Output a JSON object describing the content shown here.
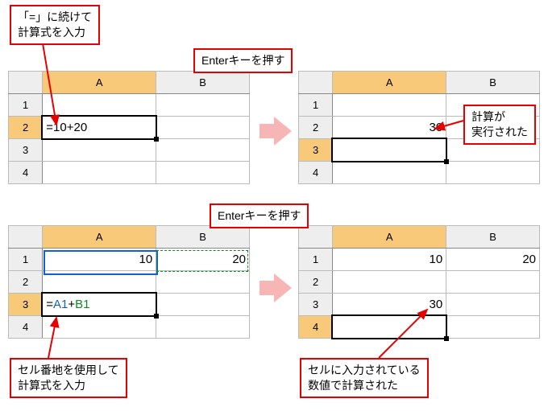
{
  "callouts": {
    "c1": "「=」に続けて\n計算式を入力",
    "c2": "Enterキーを押す",
    "c3": "計算が\n実行された",
    "c4": "Enterキーを押す",
    "c5": "セル番地を使用して\n計算式を入力",
    "c6": "セルに入力されている\n数値で計算された"
  },
  "headers": {
    "A": "A",
    "B": "B",
    "r1": "1",
    "r2": "2",
    "r3": "3",
    "r4": "4"
  },
  "grid1": {
    "a2": "=10+20"
  },
  "grid2": {
    "a2": "30"
  },
  "grid3": {
    "a1": "10",
    "b1": "20",
    "formula_eq": "=",
    "formula_a1": "A1",
    "formula_plus": "+",
    "formula_b1": "B1"
  },
  "grid4": {
    "a1": "10",
    "b1": "20",
    "a3": "30"
  },
  "chart_data": {
    "type": "table",
    "description": "Spreadsheet tutorial showing formula entry",
    "panels": [
      {
        "cell": "A2",
        "input": "=10+20",
        "result": 30
      },
      {
        "cell": "A3",
        "input": "=A1+B1",
        "refs": {
          "A1": 10,
          "B1": 20
        },
        "result": 30
      }
    ]
  }
}
